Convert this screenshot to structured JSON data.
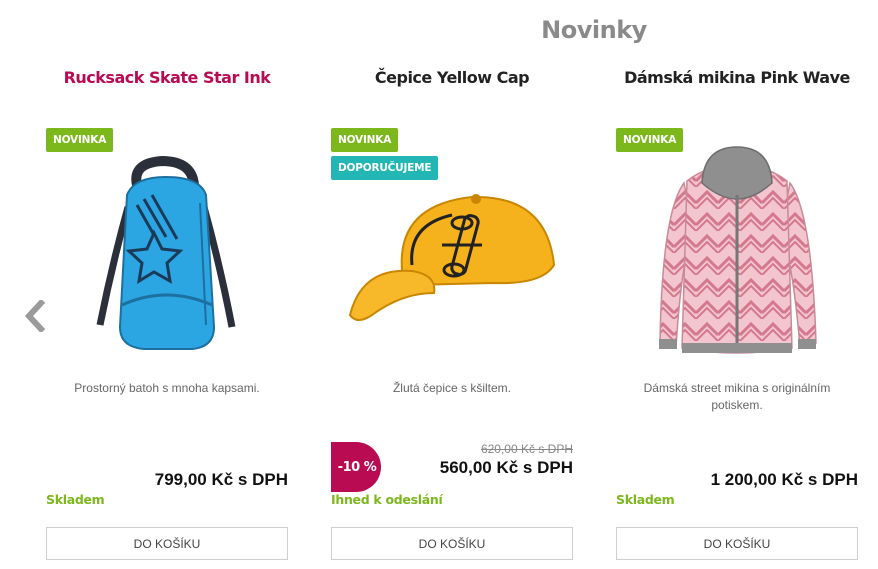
{
  "section": {
    "title": "Novinky"
  },
  "products": [
    {
      "name": "Rucksack Skate Star Ink",
      "flags": [
        "NOVINKA"
      ],
      "description": "Prostorný batoh s mnoha kapsami.",
      "price": "799,00 Kč s DPH",
      "availability": "Skladem",
      "button": "DO KOŠÍKU",
      "image": "blue-backpack"
    },
    {
      "name": "Čepice Yellow Cap",
      "flags": [
        "NOVINKA",
        "DOPORUČUJEME"
      ],
      "description": "Žlutá čepice s kšiltem.",
      "discount": "-10 %",
      "old_price": "620,00 Kč s DPH",
      "price": "560,00 Kč s DPH",
      "availability": "Ihned k odeslání",
      "button": "DO KOŠÍKU",
      "image": "yellow-cap"
    },
    {
      "name": "Dámská mikina Pink Wave",
      "flags": [
        "NOVINKA"
      ],
      "description": "Dámská street mikina s originálním potiskem.",
      "price": "1 200,00 Kč s DPH",
      "availability": "Skladem",
      "button": "DO KOŠÍKU",
      "image": "pink-hoodie"
    }
  ],
  "colors": {
    "accent": "#b80b52",
    "new_flag": "#7cb81c",
    "recommend_flag": "#22b7b5",
    "availability": "#7cb81c"
  },
  "nav": {
    "prev_icon": "chevron-left-icon"
  }
}
